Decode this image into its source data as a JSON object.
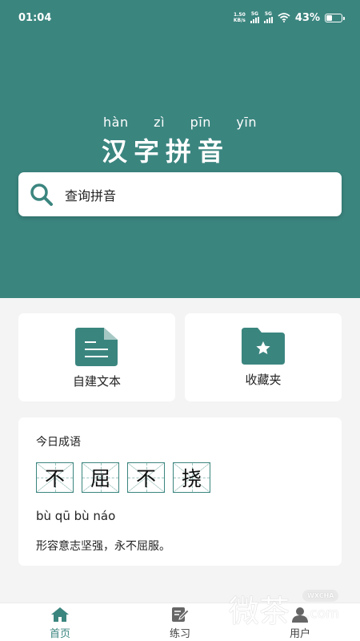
{
  "status": {
    "time": "01:04",
    "speed_value": "1.50",
    "speed_unit": "KB/s",
    "sig1": "5G",
    "sig2": "5G",
    "battery": "43%",
    "battery_level": 0.43
  },
  "header": {
    "pinyin": [
      "hàn",
      "zì",
      "pīn",
      "yīn"
    ],
    "title": "汉字拼音"
  },
  "search": {
    "placeholder": "查询拼音"
  },
  "features": [
    {
      "label": "自建文本",
      "icon": "document-icon"
    },
    {
      "label": "收藏夹",
      "icon": "star-folder-icon"
    }
  ],
  "idiom": {
    "heading": "今日成语",
    "chars": [
      "不",
      "屈",
      "不",
      "挠"
    ],
    "pinyin": "bù qū bù náo",
    "meaning": "形容意志坚强，永不屈服。"
  },
  "tabs": [
    {
      "label": "首页",
      "icon": "home-icon",
      "active": true
    },
    {
      "label": "练习",
      "icon": "edit-icon",
      "active": false
    },
    {
      "label": "用户",
      "icon": "user-icon",
      "active": false
    }
  ],
  "watermark": {
    "big": "微茶",
    "pill": "WXCHA",
    "com": ".com"
  },
  "colors": {
    "brand": "#3b857f",
    "background": "#f4f4f4"
  }
}
